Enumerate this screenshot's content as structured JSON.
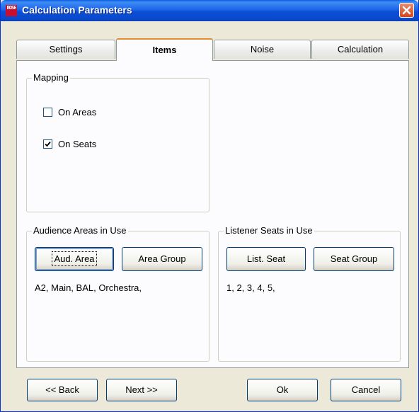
{
  "window": {
    "title": "Calculation Parameters",
    "logo_text": "BOSE"
  },
  "tabs": [
    {
      "label": "Settings",
      "active": false
    },
    {
      "label": "Items",
      "active": true
    },
    {
      "label": "Noise",
      "active": false
    },
    {
      "label": "Calculation",
      "active": false
    }
  ],
  "mapping": {
    "label": "Mapping",
    "on_areas": {
      "label": "On Areas",
      "checked": false
    },
    "on_seats": {
      "label": "On Seats",
      "checked": true
    }
  },
  "audience_areas": {
    "label": "Audience Areas in Use",
    "aud_area_button": "Aud. Area",
    "area_group_button": "Area Group",
    "items_text": "A2, Main, BAL, Orchestra,"
  },
  "listener_seats": {
    "label": "Listener Seats in Use",
    "list_seat_button": "List. Seat",
    "seat_group_button": "Seat Group",
    "items_text": "1, 2, 3, 4, 5,"
  },
  "footer": {
    "back": "<< Back",
    "next": "Next >>",
    "ok": "Ok",
    "cancel": "Cancel"
  }
}
